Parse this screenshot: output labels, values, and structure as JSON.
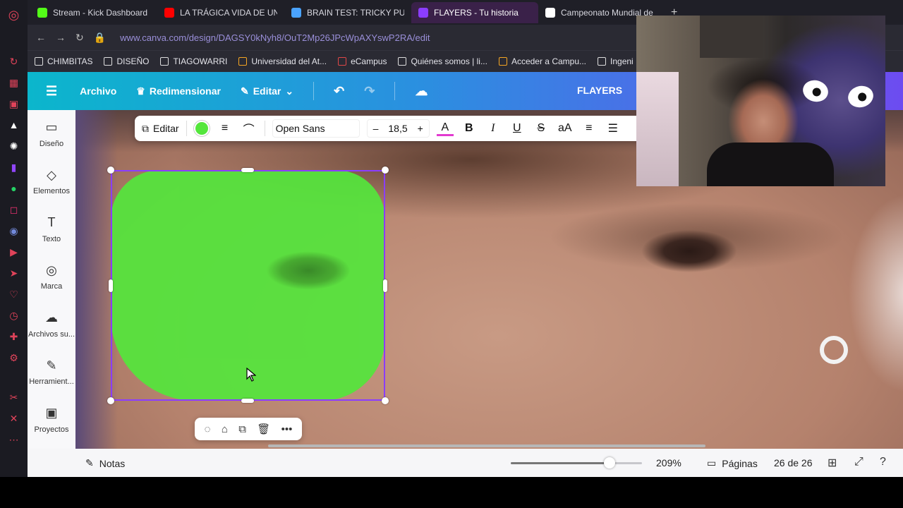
{
  "browser": {
    "tabs": [
      {
        "title": "Stream - Kick Dashboard",
        "color": "#53fc18",
        "active": false
      },
      {
        "title": "LA TRÁGICA VIDA DE UN",
        "color": "#ff0000",
        "active": false
      },
      {
        "title": "BRAIN TEST: TRICKY PU",
        "color": "#4aa3ff",
        "active": false
      },
      {
        "title": "FLAYERS - Tu historia",
        "color": "#8b3dff",
        "active": true
      },
      {
        "title": "Campeonato Mundial de",
        "color": "#ffffff",
        "active": false
      }
    ],
    "new_tab": "+",
    "url": "www.canva.com/design/DAGSY0kNyh8/OuT2Mp26JPcWpAXYswP2RA/edit",
    "bookmarks": [
      {
        "label": "CHIMBITAS",
        "icon": "folder-icon"
      },
      {
        "label": "DISEÑO",
        "icon": "folder-icon"
      },
      {
        "label": "TIAGOWARRI",
        "icon": "folder-icon"
      },
      {
        "label": "Universidad del At...",
        "icon": "university-icon"
      },
      {
        "label": "eCampus",
        "icon": "ecampus-icon"
      },
      {
        "label": "Quiénes somos | li...",
        "icon": "wix-icon"
      },
      {
        "label": "Acceder a Campu...",
        "icon": "campus-icon"
      },
      {
        "label": "Ingeni",
        "icon": "page-icon"
      }
    ]
  },
  "canva": {
    "header": {
      "file": "Archivo",
      "resize": "Redimensionar",
      "edit": "Editar",
      "project_title": "FLAYERS"
    },
    "sidebar": [
      {
        "label": "Diseño",
        "icon": "layout-icon",
        "glyph": "▭"
      },
      {
        "label": "Elementos",
        "icon": "elements-icon",
        "glyph": "◇"
      },
      {
        "label": "Texto",
        "icon": "text-icon",
        "glyph": "T"
      },
      {
        "label": "Marca",
        "icon": "brand-icon",
        "glyph": "◎"
      },
      {
        "label": "Archivos su...",
        "icon": "upload-icon",
        "glyph": "☁"
      },
      {
        "label": "Herramient...",
        "icon": "tools-icon",
        "glyph": "✎"
      },
      {
        "label": "Proyectos",
        "icon": "folder-icon",
        "glyph": "▣"
      }
    ],
    "text_toolbar": {
      "edit": "Editar",
      "font": "Open Sans",
      "size": "18,5",
      "minus": "–",
      "plus": "+",
      "text_color": "A",
      "bold": "B",
      "italic": "I",
      "underline": "U",
      "strike": "S",
      "case": "aA"
    },
    "shape_color": "#54e63c",
    "selection_color": "#8b3dff",
    "bottom": {
      "notes": "Notas",
      "zoom": "209%",
      "zoom_fraction": 0.75,
      "pages": "Páginas",
      "page_count": "26 de 26"
    }
  }
}
